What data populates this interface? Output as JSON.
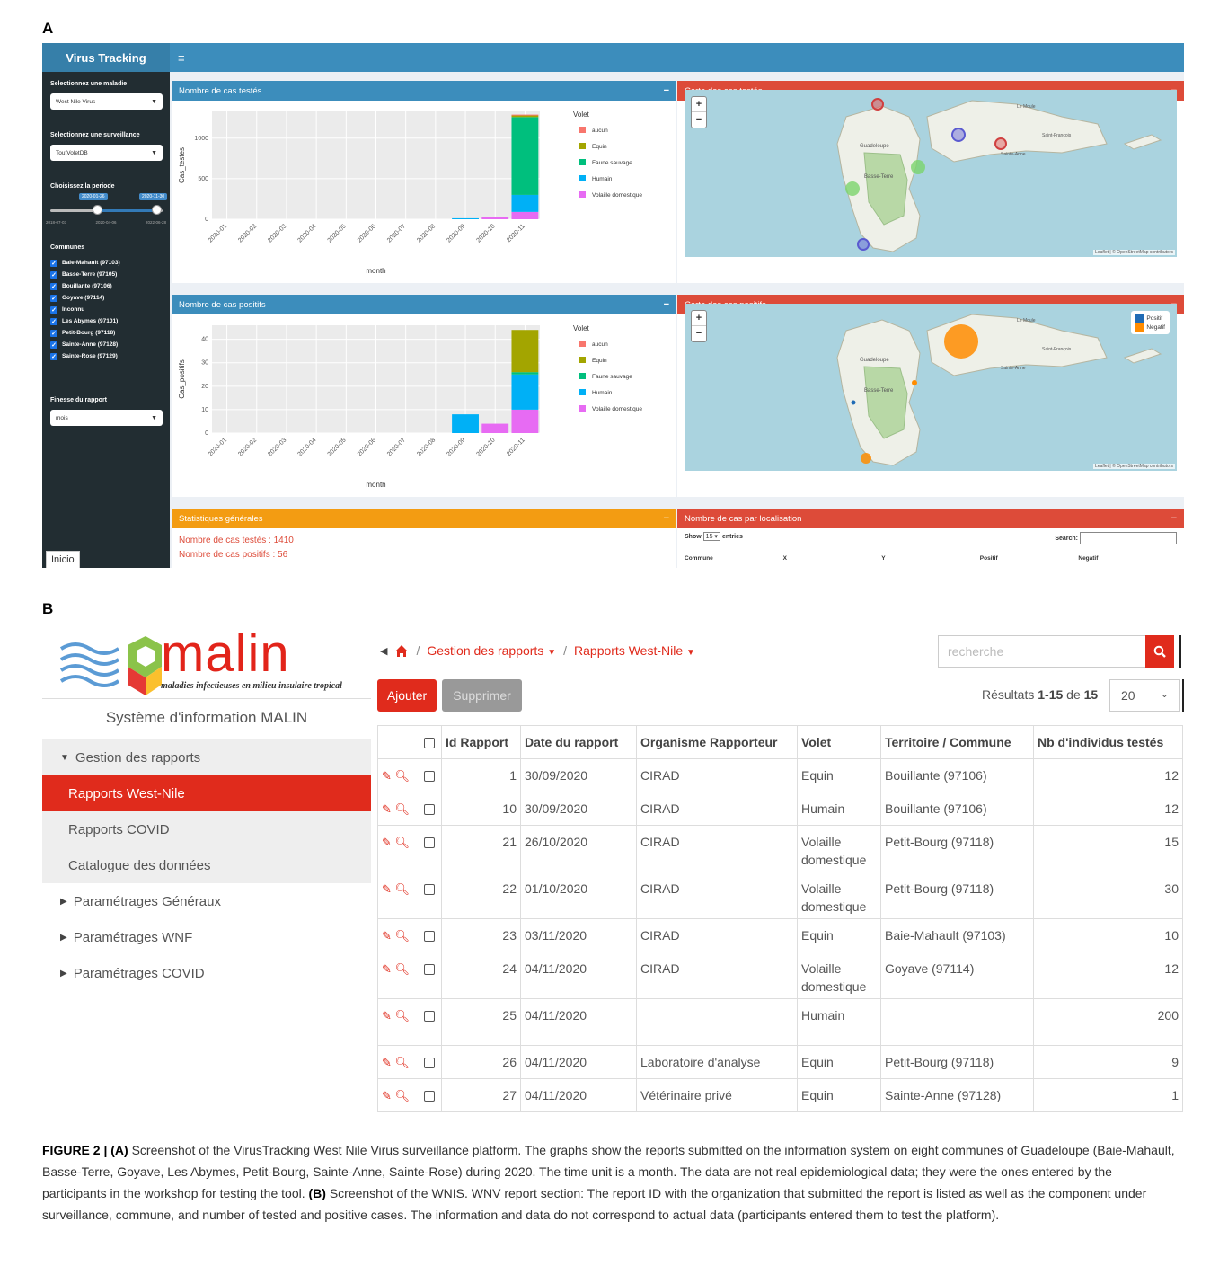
{
  "panel_a": {
    "letter": "A",
    "sidebar": {
      "title": "Virus Tracking",
      "disease_label": "Selectionnez une maladie",
      "disease_value": "West Nile Virus",
      "surveillance_label": "Selectionnez une surveillance",
      "surveillance_value": "ToutVoletDB",
      "period_label": "Choisissez la periode",
      "period_from": "2020-01-26",
      "period_to": "2020-11-30",
      "slider_ticks": [
        "2018-07-03",
        "2020-04-06",
        "2022-06-28"
      ],
      "communes_label": "Communes",
      "communes": [
        "Baie-Mahault (97103)",
        "Basse-Terre (97105)",
        "Bouillante (97106)",
        "Goyave (97114)",
        "Inconnu",
        "Les Abymes (97101)",
        "Petit-Bourg (97118)",
        "Sainte-Anne (97128)",
        "Sainte-Rose (97129)"
      ],
      "finesse_label": "Finesse du rapport",
      "finesse_value": "mois",
      "inicio": "Inicio"
    },
    "topbar_icon": "≡",
    "box_tested": {
      "title": "Nombre de cas testés",
      "minimize": "−"
    },
    "box_positive": {
      "title": "Nombre de cas positifs",
      "minimize": "−"
    },
    "map_tested": {
      "title": "Carte des cas testés",
      "minimize": "−",
      "zoom_in": "+",
      "zoom_out": "−",
      "attribution": "Leaflet | © OpenStreetMap contributors"
    },
    "map_positive": {
      "title": "Carte des cas positifs",
      "minimize": "−",
      "zoom_in": "+",
      "zoom_out": "−",
      "attribution": "Leaflet | © OpenStreetMap contributors",
      "legend": [
        "Positif",
        "Negatif"
      ]
    },
    "map_places": {
      "basse_terre": "Basse-Terre",
      "guadeloupe": "Guadeloupe",
      "saint_francois": "Saint-François",
      "sainte_anne": "Sainte-Anne",
      "le_moule": "Le Moule"
    },
    "stats": {
      "title": "Statistiques générales",
      "minimize": "−",
      "tested": "Nombre de cas testés : 1410",
      "positive": "Nombre de cas positifs : 56"
    },
    "loc_table": {
      "title": "Nombre de cas par localisation",
      "minimize": "−",
      "show": "Show",
      "entries_value": "15",
      "entries": "entries",
      "search": "Search:",
      "columns": [
        "Commune",
        "X",
        "Y",
        "Positif",
        "Negatif"
      ]
    }
  },
  "chart_data": [
    {
      "type": "bar",
      "stacked": true,
      "ylabel": "Cas_testes",
      "xlabel": "month",
      "categories": [
        "2020-01",
        "2020-02",
        "2020-03",
        "2020-04",
        "2020-05",
        "2020-06",
        "2020-07",
        "2020-08",
        "2020-09",
        "2020-10",
        "2020-11"
      ],
      "yticks": [
        0,
        500,
        1000
      ],
      "ylim": [
        0,
        1330
      ],
      "legend_title": "Volet",
      "series": [
        {
          "name": "aucun",
          "color": "#F8766D",
          "values": [
            0,
            0,
            0,
            0,
            0,
            0,
            0,
            0,
            0,
            0,
            10
          ]
        },
        {
          "name": "Equin",
          "color": "#A3A500",
          "values": [
            0,
            0,
            0,
            0,
            0,
            0,
            0,
            0,
            0,
            0,
            20
          ]
        },
        {
          "name": "Faune sauvage",
          "color": "#00BF7D",
          "values": [
            0,
            0,
            0,
            0,
            0,
            0,
            0,
            0,
            0,
            0,
            960
          ]
        },
        {
          "name": "Humain",
          "color": "#00B0F6",
          "values": [
            0,
            0,
            0,
            0,
            0,
            0,
            0,
            0,
            12,
            0,
            210
          ]
        },
        {
          "name": "Volaille domestique",
          "color": "#E76BF3",
          "values": [
            0,
            0,
            0,
            0,
            0,
            0,
            0,
            0,
            0,
            27,
            90
          ]
        }
      ]
    },
    {
      "type": "bar",
      "stacked": true,
      "ylabel": "Cas_positifs",
      "xlabel": "month",
      "categories": [
        "2020-01",
        "2020-02",
        "2020-03",
        "2020-04",
        "2020-05",
        "2020-06",
        "2020-07",
        "2020-08",
        "2020-09",
        "2020-10",
        "2020-11"
      ],
      "yticks": [
        0,
        10,
        20,
        30,
        40
      ],
      "ylim": [
        0,
        46
      ],
      "legend_title": "Volet",
      "series": [
        {
          "name": "aucun",
          "color": "#F8766D",
          "values": [
            0,
            0,
            0,
            0,
            0,
            0,
            0,
            0,
            0,
            0,
            0
          ]
        },
        {
          "name": "Equin",
          "color": "#A3A500",
          "values": [
            0,
            0,
            0,
            0,
            0,
            0,
            0,
            0,
            0,
            0,
            18
          ]
        },
        {
          "name": "Faune sauvage",
          "color": "#00BF7D",
          "values": [
            0,
            0,
            0,
            0,
            0,
            0,
            0,
            0,
            0,
            0,
            1
          ]
        },
        {
          "name": "Humain",
          "color": "#00B0F6",
          "values": [
            0,
            0,
            0,
            0,
            0,
            0,
            0,
            0,
            8,
            0,
            15
          ]
        },
        {
          "name": "Volaille domestique",
          "color": "#E76BF3",
          "values": [
            0,
            0,
            0,
            0,
            0,
            0,
            0,
            0,
            0,
            4,
            10
          ]
        }
      ]
    }
  ],
  "panel_b": {
    "letter": "B",
    "logo": {
      "word": "malin",
      "subtitle": "maladies infectieuses en milieu insulaire tropical"
    },
    "system_name": "Système d'information MALIN",
    "nav": {
      "group": "Gestion des rapports",
      "active": "Rapports West-Nile",
      "covid": "Rapports COVID",
      "catalogue": "Catalogue des données",
      "general": "Paramétrages Généraux",
      "wnf": "Paramétrages WNF",
      "covid_settings": "Paramétrages COVID"
    },
    "breadcrumb": {
      "sep": "/",
      "item1": "Gestion des rapports",
      "item2": "Rapports West-Nile"
    },
    "search_placeholder": "recherche",
    "buttons": {
      "add": "Ajouter",
      "delete": "Supprimer"
    },
    "results": {
      "prefix": "Résultats",
      "range": "1-15",
      "de": "de",
      "total": "15"
    },
    "page_size": "20",
    "columns": [
      "Id Rapport",
      "Date du rapport",
      "Organisme Rapporteur",
      "Volet",
      "Territoire / Commune",
      "Nb d'individus testés"
    ],
    "rows": [
      {
        "id": "1",
        "date": "30/09/2020",
        "org": "CIRAD",
        "volet": "Equin",
        "commune": "Bouillante (97106)",
        "tested": "12"
      },
      {
        "id": "10",
        "date": "30/09/2020",
        "org": "CIRAD",
        "volet": "Humain",
        "commune": "Bouillante (97106)",
        "tested": "12"
      },
      {
        "id": "21",
        "date": "26/10/2020",
        "org": "CIRAD",
        "volet": "Volaille domestique",
        "commune": "Petit-Bourg (97118)",
        "tested": "15"
      },
      {
        "id": "22",
        "date": "01/10/2020",
        "org": "CIRAD",
        "volet": "Volaille domestique",
        "commune": "Petit-Bourg (97118)",
        "tested": "30"
      },
      {
        "id": "23",
        "date": "03/11/2020",
        "org": "CIRAD",
        "volet": "Equin",
        "commune": "Baie-Mahault (97103)",
        "tested": "10"
      },
      {
        "id": "24",
        "date": "04/11/2020",
        "org": "CIRAD",
        "volet": "Volaille domestique",
        "commune": "Goyave (97114)",
        "tested": "12"
      },
      {
        "id": "25",
        "date": "04/11/2020",
        "org": "",
        "volet": "Humain",
        "commune": "",
        "tested": "200"
      },
      {
        "id": "26",
        "date": "04/11/2020",
        "org": "Laboratoire d'analyse",
        "volet": "Equin",
        "commune": "Petit-Bourg (97118)",
        "tested": "9"
      },
      {
        "id": "27",
        "date": "04/11/2020",
        "org": "Vétérinaire privé",
        "volet": "Equin",
        "commune": "Sainte-Anne (97128)",
        "tested": "1"
      }
    ]
  },
  "caption": {
    "label": "FIGURE 2 |",
    "a": "(A)",
    "text_a": " Screenshot of the VirusTracking West Nile Virus surveillance platform. The graphs show the reports submitted on the information system on eight communes of Guadeloupe (Baie-Mahault, Basse-Terre, Goyave, Les Abymes, Petit-Bourg, Sainte-Anne, Sainte-Rose) during 2020. The time unit is a month. The data are not real epidemiological data; they were the ones entered by the participants in the workshop for testing the tool. ",
    "b": "(B)",
    "text_b": " Screenshot of the WNIS. WNV report section: The report ID with the organization that submitted the report is listed as well as the component under surveillance, commune, and number of tested and positive cases. The information and data do not correspond to actual data (participants entered them to test the platform)."
  }
}
